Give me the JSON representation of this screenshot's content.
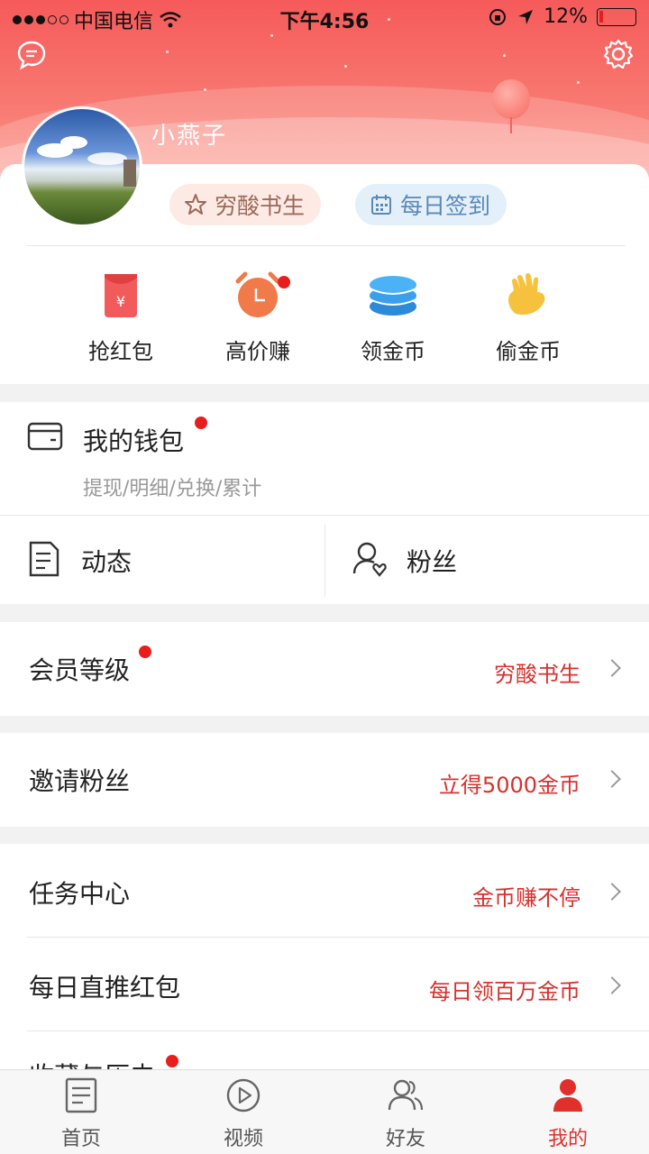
{
  "status_bar": {
    "carrier": "中国电信",
    "time": "下午4:56",
    "battery": "12%"
  },
  "profile": {
    "username": "小燕子",
    "rank_badge": "穷酸书生",
    "checkin_badge": "每日签到"
  },
  "quick_actions": [
    {
      "label": "抢红包",
      "icon": "red-envelope-icon"
    },
    {
      "label": "高价赚",
      "icon": "alarm-clock-icon"
    },
    {
      "label": "领金币",
      "icon": "coin-stack-icon"
    },
    {
      "label": "偷金币",
      "icon": "hand-icon"
    }
  ],
  "wallet": {
    "title": "我的钱包",
    "subtitle": "提现/明细/兑换/累计"
  },
  "feed": {
    "dynamics_label": "动态",
    "fans_label": "粉丝"
  },
  "menu": {
    "member_level": {
      "title": "会员等级",
      "value": "穷酸书生"
    },
    "invite_fans": {
      "title": "邀请粉丝",
      "value": "立得5000金币"
    },
    "task_center": {
      "title": "任务中心",
      "value": "金币赚不停"
    },
    "daily_push": {
      "title": "每日直推红包",
      "value": "每日领百万金币"
    },
    "favorites_history": {
      "title": "收藏与历史"
    }
  },
  "tabbar": {
    "items": [
      {
        "label": "首页",
        "icon": "document-icon"
      },
      {
        "label": "视频",
        "icon": "play-circle-icon"
      },
      {
        "label": "好友",
        "icon": "friends-icon"
      },
      {
        "label": "我的",
        "icon": "person-icon"
      }
    ],
    "active_index": 3
  },
  "colors": {
    "header_red": "#f65a5a",
    "accent_red": "#d9302c",
    "notification_dot": "#e81e1e"
  }
}
